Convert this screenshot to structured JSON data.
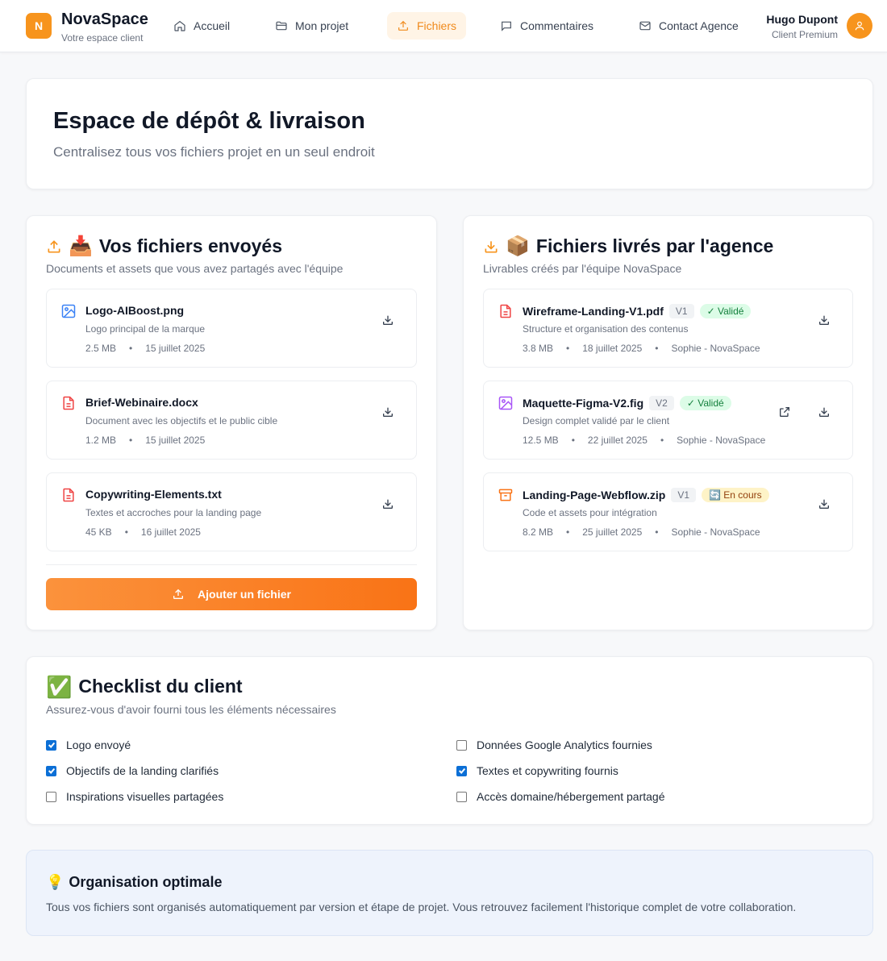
{
  "brand": {
    "logo_letter": "N",
    "name": "NovaSpace",
    "subtitle": "Votre espace client",
    "accent": "#f7941d"
  },
  "nav": [
    {
      "label": "Accueil",
      "icon": "home-icon"
    },
    {
      "label": "Mon projet",
      "icon": "folder-icon"
    },
    {
      "label": "Fichiers",
      "icon": "upload-icon",
      "active": true
    },
    {
      "label": "Commentaires",
      "icon": "comment-icon"
    },
    {
      "label": "Contact Agence",
      "icon": "mail-icon"
    }
  ],
  "user": {
    "name": "Hugo Dupont",
    "role": "Client Premium"
  },
  "hero": {
    "title": "Espace de dépôt & livraison",
    "subtitle": "Centralisez tous vos fichiers projet en un seul endroit"
  },
  "sent": {
    "emoji": "📥",
    "title": "Vos fichiers envoyés",
    "subtitle": "Documents et assets que vous avez partagés avec l'équipe",
    "files": [
      {
        "name": "Logo-AIBoost.png",
        "desc": "Logo principal de la marque",
        "size": "2.5 MB",
        "date": "15 juillet 2025",
        "icon": "image-icon"
      },
      {
        "name": "Brief-Webinaire.docx",
        "desc": "Document avec les objectifs et le public cible",
        "size": "1.2 MB",
        "date": "15 juillet 2025",
        "icon": "document-icon"
      },
      {
        "name": "Copywriting-Elements.txt",
        "desc": "Textes et accroches pour la landing page",
        "size": "45 KB",
        "date": "16 juillet 2025",
        "icon": "document-icon"
      }
    ],
    "add_label": "Ajouter un fichier"
  },
  "delivered": {
    "emoji": "📦",
    "title": "Fichiers livrés par l'agence",
    "subtitle": "Livrables créés par l'équipe NovaSpace",
    "files": [
      {
        "name": "Wireframe-Landing-V1.pdf",
        "version": "V1",
        "status": "✓ Validé",
        "desc": "Structure et organisation des contenus",
        "size": "3.8 MB",
        "date": "18 juillet 2025",
        "author": "Sophie - NovaSpace",
        "icon": "document-icon"
      },
      {
        "name": "Maquette-Figma-V2.fig",
        "version": "V2",
        "status": "✓ Validé",
        "desc": "Design complet validé par le client",
        "size": "12.5 MB",
        "date": "22 juillet 2025",
        "author": "Sophie - NovaSpace",
        "icon": "image-icon"
      },
      {
        "name": "Landing-Page-Webflow.zip",
        "version": "V1",
        "status": "🔄 En cours",
        "desc": "Code et assets pour intégration",
        "size": "8.2 MB",
        "date": "25 juillet 2025",
        "author": "Sophie - NovaSpace",
        "icon": "archive-icon"
      }
    ]
  },
  "checklist": {
    "emoji": "✅",
    "title": "Checklist du client",
    "subtitle": "Assurez-vous d'avoir fourni tous les éléments nécessaires",
    "items": [
      {
        "label": "Logo envoyé",
        "checked": true
      },
      {
        "label": "Objectifs de la landing clarifiés",
        "checked": true
      },
      {
        "label": "Inspirations visuelles partagées",
        "checked": false
      },
      {
        "label": "Données Google Analytics fournies",
        "checked": false
      },
      {
        "label": "Textes et copywriting fournis",
        "checked": true
      },
      {
        "label": "Accès domaine/hébergement partagé",
        "checked": false
      }
    ]
  },
  "tip": {
    "emoji": "💡",
    "title": "Organisation optimale",
    "text": "Tous vos fichiers sont organisés automatiquement par version et étape de projet. Vous retrouvez facilement l'historique complet de votre collaboration."
  }
}
